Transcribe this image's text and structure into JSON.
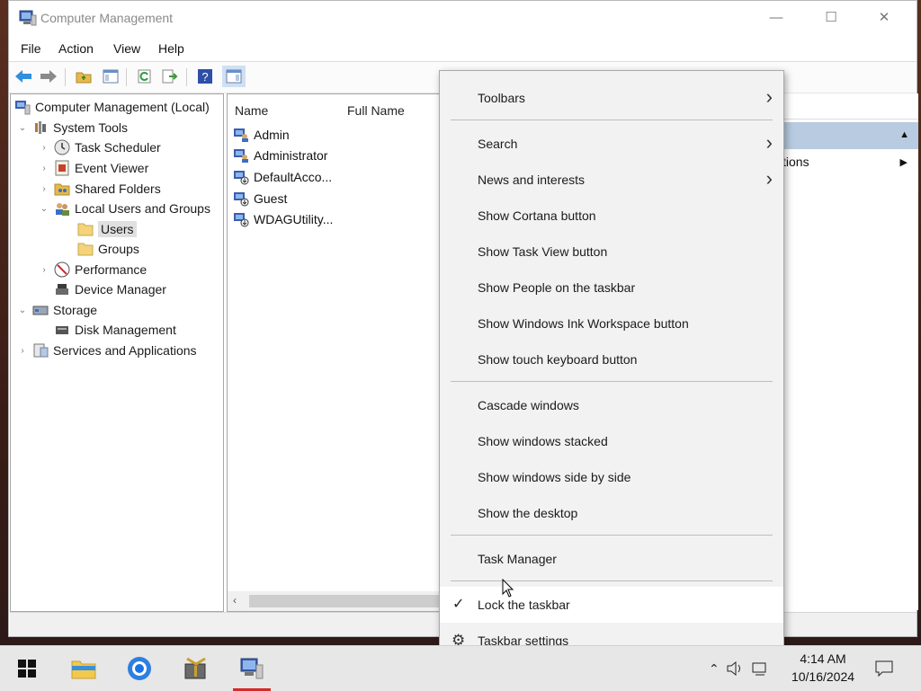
{
  "window": {
    "title": "Computer Management",
    "controls": {
      "minimize": "—",
      "maximize": "☐",
      "close": "✕"
    }
  },
  "menubar": [
    "File",
    "Action",
    "View",
    "Help"
  ],
  "tree": {
    "root": "Computer Management (Local)",
    "system_tools": "System Tools",
    "task_scheduler": "Task Scheduler",
    "event_viewer": "Event Viewer",
    "shared_folders": "Shared Folders",
    "local_users_groups": "Local Users and Groups",
    "users": "Users",
    "groups": "Groups",
    "performance": "Performance",
    "device_manager": "Device Manager",
    "storage": "Storage",
    "disk_management": "Disk Management",
    "services_apps": "Services and Applications"
  },
  "list": {
    "headers": {
      "name": "Name",
      "full_name": "Full Name"
    },
    "rows": [
      "Admin",
      "Administrator",
      "DefaultAcco...",
      "Guest",
      "WDAGUtility..."
    ]
  },
  "actions": {
    "partial_label": "tions"
  },
  "context_menu": {
    "toolbars": "Toolbars",
    "search": "Search",
    "news": "News and interests",
    "cortana": "Show Cortana button",
    "task_view": "Show Task View button",
    "people": "Show People on the taskbar",
    "ink": "Show Windows Ink Workspace button",
    "touch_keyboard": "Show touch keyboard button",
    "cascade": "Cascade windows",
    "stacked": "Show windows stacked",
    "side_by_side": "Show windows side by side",
    "desktop": "Show the desktop",
    "task_manager": "Task Manager",
    "lock": "Lock the taskbar",
    "settings": "Taskbar settings",
    "lock_checked": true
  },
  "taskbar": {
    "time": "4:14 AM",
    "date": "10/16/2024",
    "active_color": "#d62a2a"
  }
}
